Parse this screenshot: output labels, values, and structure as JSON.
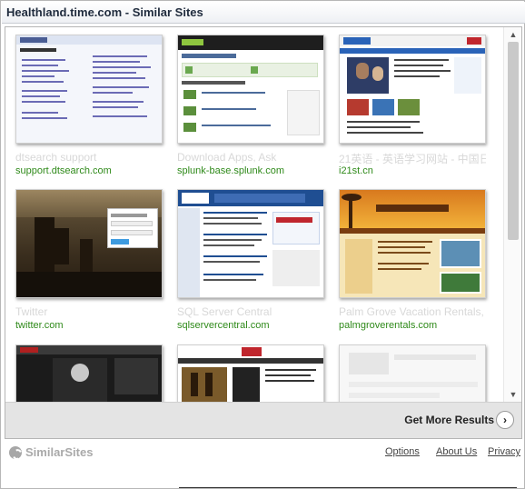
{
  "window": {
    "title": "Healthland.time.com - Similar Sites"
  },
  "cards": [
    {
      "title": "dtsearch support",
      "domain": "support.dtsearch.com",
      "thumb_style": "dtsearch"
    },
    {
      "title": "Download Apps, Ask",
      "domain": "splunk-base.splunk.com",
      "thumb_style": "splunk"
    },
    {
      "title": "21英语 - 英语学习网站 - 中国日",
      "domain": "i21st.cn",
      "thumb_style": "i21st"
    },
    {
      "title": "Twitter",
      "domain": "twitter.com",
      "thumb_style": "twitter"
    },
    {
      "title": "SQL Server Central",
      "domain": "sqlservercentral.com",
      "thumb_style": "sqlserver"
    },
    {
      "title": "Palm Grove Vacation Rentals,",
      "domain": "palmgroverentals.com",
      "thumb_style": "palmgrove"
    },
    {
      "title": "",
      "domain": "",
      "thumb_style": "dark"
    },
    {
      "title": "",
      "domain": "",
      "thumb_style": "time"
    },
    {
      "title": "",
      "domain": "",
      "thumb_style": "loading"
    }
  ],
  "more": {
    "label": "Get More Results",
    "arrow": "›"
  },
  "footer": {
    "brand": "SimilarSites",
    "links": [
      "Options",
      "About Us",
      "Privacy"
    ]
  },
  "scrollbar": {
    "up": "▲",
    "down": "▼"
  },
  "colors": {
    "domain": "#2f8a1a",
    "title": "#d8d8d8",
    "bar": "#e4e4e4"
  }
}
